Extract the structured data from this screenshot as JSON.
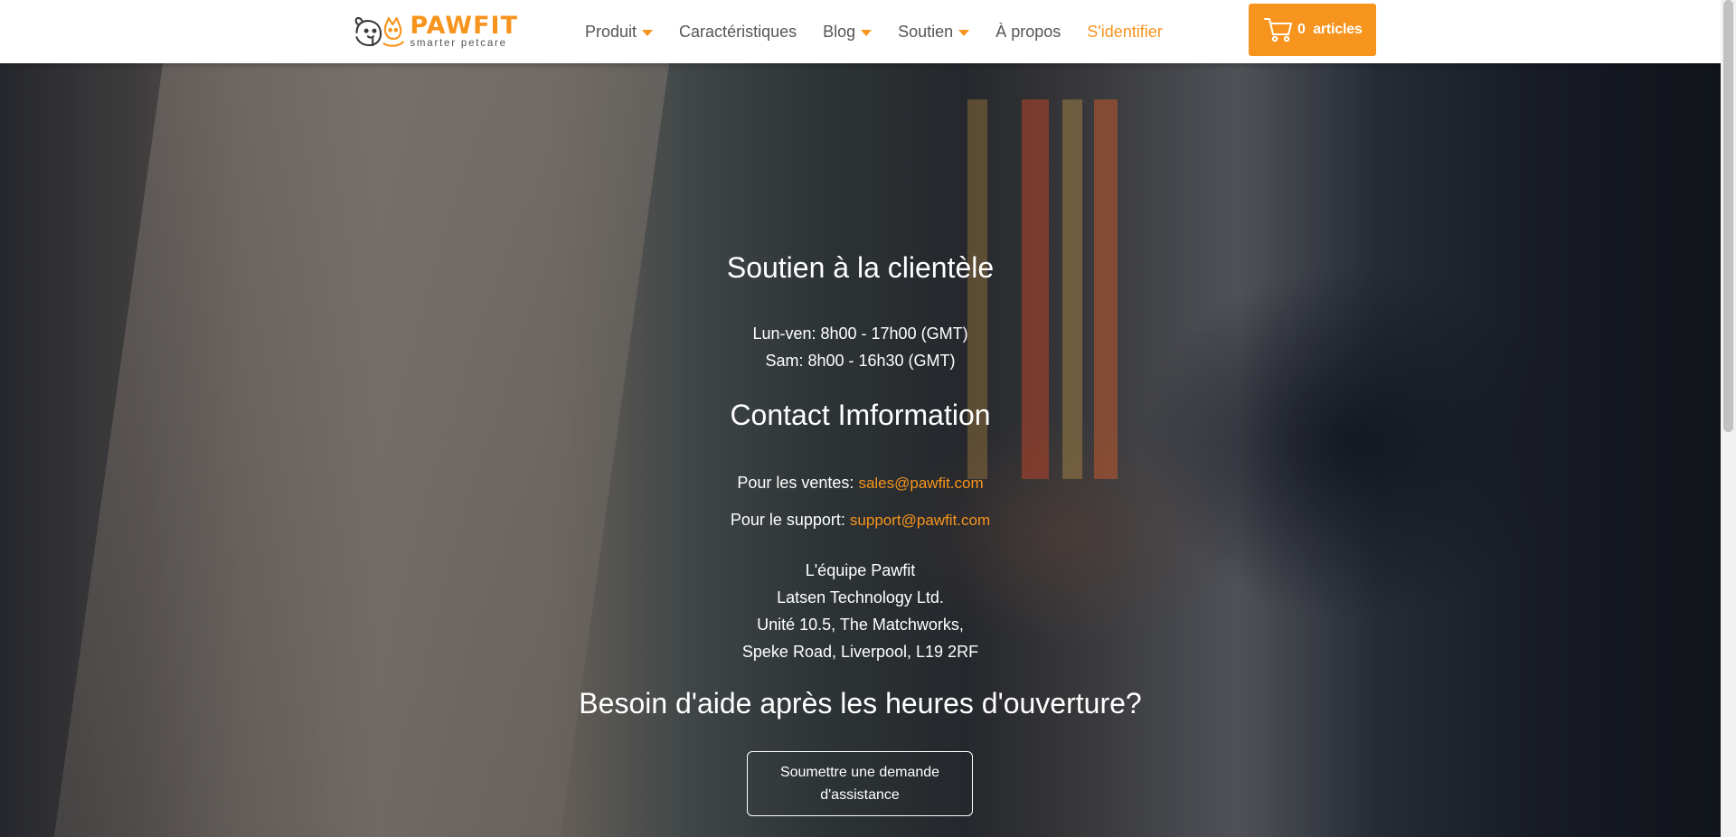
{
  "header": {
    "logo": {
      "name": "PAWFIT",
      "tagline": "smarter petcare"
    },
    "nav": [
      {
        "label": "Produit",
        "dropdown": true
      },
      {
        "label": "Caractéristiques",
        "dropdown": false
      },
      {
        "label": "Blog",
        "dropdown": true
      },
      {
        "label": "Soutien",
        "dropdown": true
      },
      {
        "label": "À propos",
        "dropdown": false
      }
    ],
    "login_label": "S'identifier",
    "cart_label": "0  articles"
  },
  "support": {
    "title": "Soutien à la clientèle",
    "hours_weekday": "Lun-ven: 8h00 - 17h00 (GMT)",
    "hours_saturday": "Sam: 8h00 - 16h30 (GMT)"
  },
  "contact": {
    "title": "Contact Imformation",
    "sales_label": "Pour les ventes: ",
    "sales_email": "sales@pawfit.com",
    "support_label": "Pour le support: ",
    "support_email": "support@pawfit.com",
    "address": [
      "L'équipe Pawfit",
      "Latsen Technology Ltd.",
      "Unité 10.5, The Matchworks,",
      "Speke Road, Liverpool, L19 2RF"
    ]
  },
  "after_hours": {
    "title": "Besoin d'aide après les heures d'ouverture?",
    "button_label": "Soumettre une demande d'assistance"
  },
  "colors": {
    "accent": "#f7941d",
    "header_bg": "#ffffff",
    "text_on_hero": "#ffffff"
  },
  "icons": {
    "cart": "cart-icon",
    "logo": "pawfit-pets-logo-icon",
    "dropdown": "caret-down-icon"
  }
}
